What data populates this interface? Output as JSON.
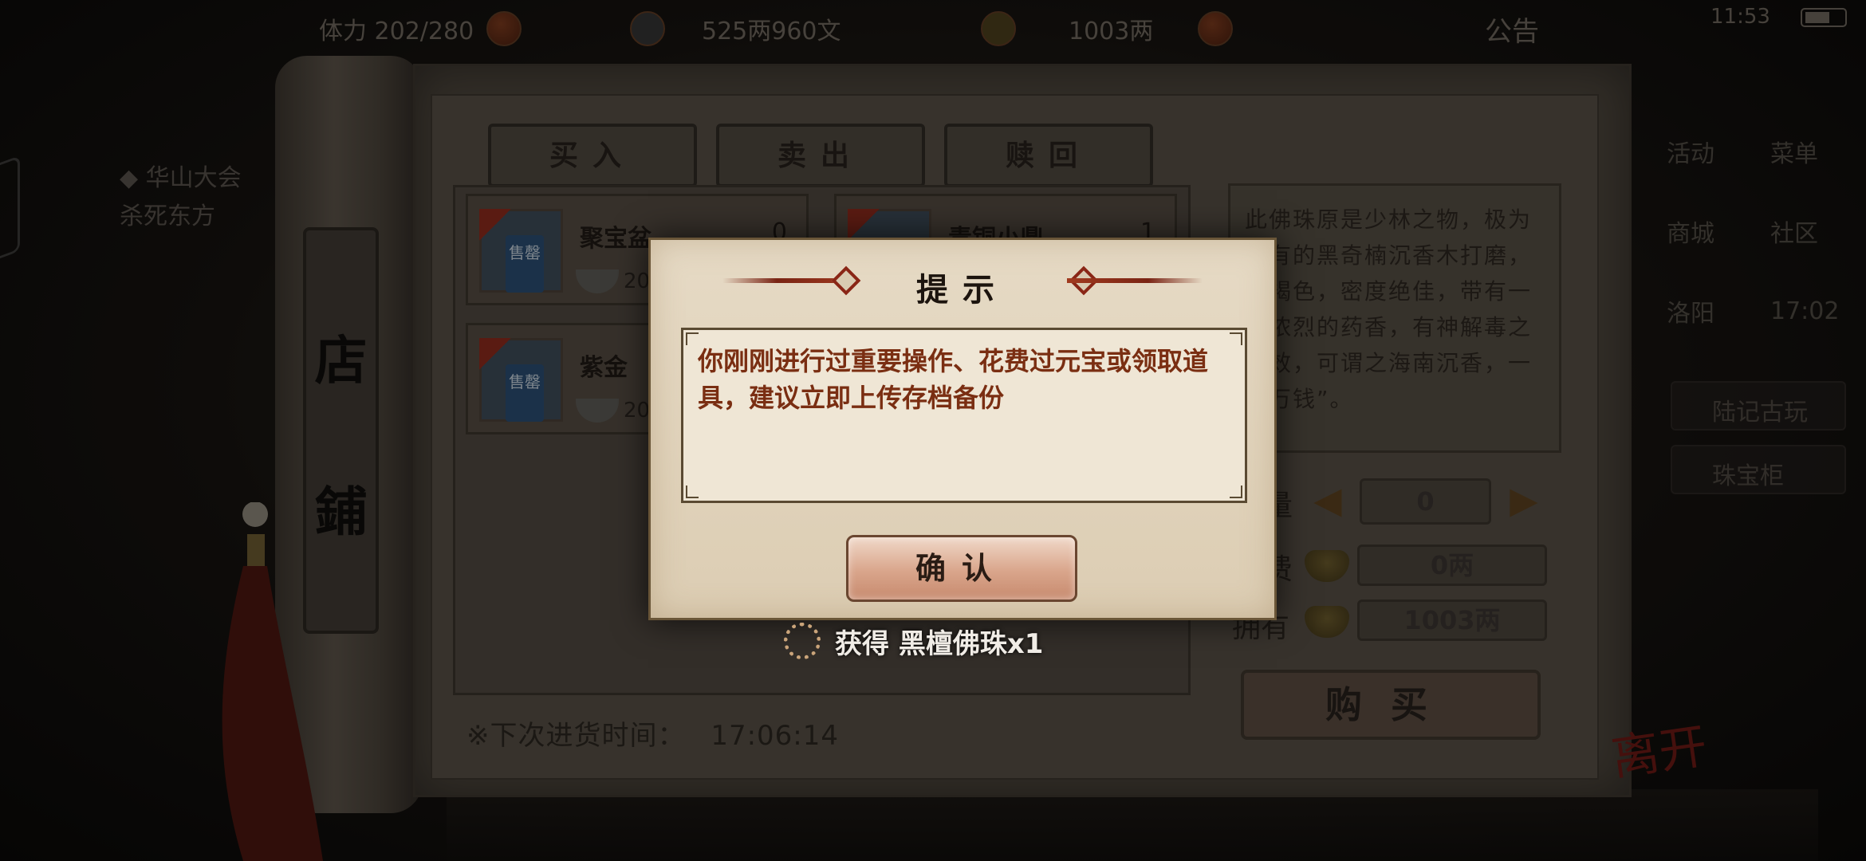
{
  "hud": {
    "stamina": "体力 202/280",
    "copper": "525两960文",
    "ingots": "1003两",
    "notice": "公告",
    "clock": "11:53"
  },
  "quest": {
    "line1": "◆ 华山大会",
    "line2": "杀死东方"
  },
  "right_menu": {
    "row1": [
      "活动",
      "菜单"
    ],
    "row2": [
      "商城",
      "社区"
    ],
    "row3": [
      "洛阳",
      "17:02"
    ],
    "item1": "陆记古玩",
    "item2": "珠宝柜"
  },
  "shop": {
    "title_chars": [
      "店",
      "鋪"
    ],
    "tabs": [
      "买入",
      "卖出",
      "赎回"
    ],
    "goods": [
      {
        "name": "聚宝盆",
        "count": "0",
        "price": "20",
        "sold": "售罄"
      },
      {
        "name": "青铜小鼎",
        "count": "1",
        "price": "",
        "sold": ""
      },
      {
        "name": "紫金",
        "count": "",
        "price": "20",
        "sold": "售罄"
      }
    ],
    "restock_label": "※下次进货时间：",
    "restock_time": "17:06:14",
    "description": "此佛珠原是少林之物，极为稀有的黑奇楠沉香木打磨，黑褐色，密度绝佳，带有一股浓烈的药香，有神解毒之奇效，可谓之海南沉香，一片万钱”。",
    "qty_label": "量",
    "cost_label": "费",
    "have_label": "拥有",
    "qty_value": "0",
    "cost_value": "0两",
    "have_value": "1003两",
    "buy_label": "购买",
    "seal": "离开"
  },
  "dialog": {
    "title": "提示",
    "message": "你刚刚进行过重要操作、花费过元宝或领取道具，建议立即上传存档备份",
    "confirm": "确认"
  },
  "toast": {
    "text": "获得 黑檀佛珠x1"
  }
}
